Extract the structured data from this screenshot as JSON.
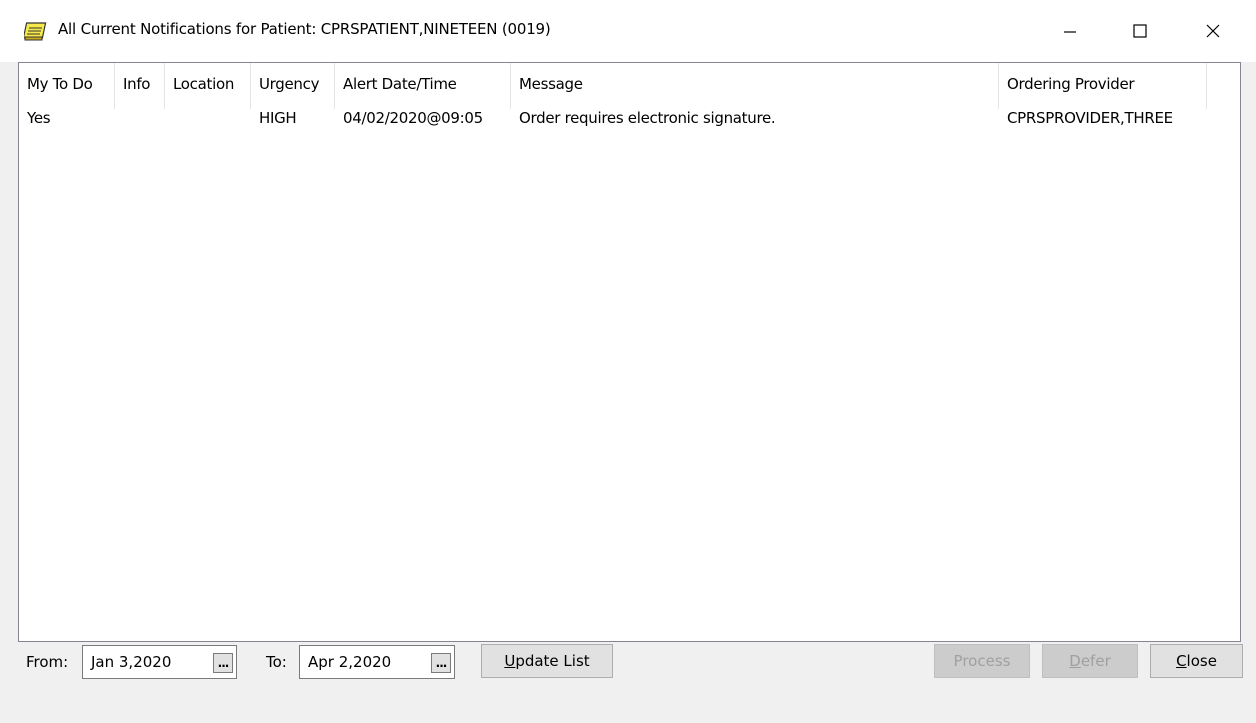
{
  "window": {
    "title": "All Current Notifications for Patient: CPRSPATIENT,NINETEEN (0019)",
    "icon": "notebook-icon",
    "controls": [
      "minimize-icon",
      "maximize-icon",
      "close-icon"
    ]
  },
  "list": {
    "columns": [
      "My To Do",
      "Info",
      "Location",
      "Urgency",
      "Alert Date/Time",
      "Message",
      "Ordering Provider"
    ],
    "rows": [
      {
        "my_to_do": "Yes",
        "info": "",
        "location": "",
        "urgency": "HIGH",
        "alert_datetime": "04/02/2020@09:05",
        "message": "Order requires electronic signature.",
        "ordering_provider": "CPRSPROVIDER,THREE"
      }
    ]
  },
  "filters": {
    "from_label": "From:",
    "from_value": "Jan 3,2020",
    "to_label": "To:",
    "to_value": "Apr 2,2020",
    "picker_label": "..."
  },
  "buttons": {
    "update_list": {
      "accel": "U",
      "rest": "pdate List"
    },
    "process": "Process",
    "defer": {
      "accel": "D",
      "rest": "efer"
    },
    "close": {
      "accel": "C",
      "rest": "lose"
    }
  }
}
